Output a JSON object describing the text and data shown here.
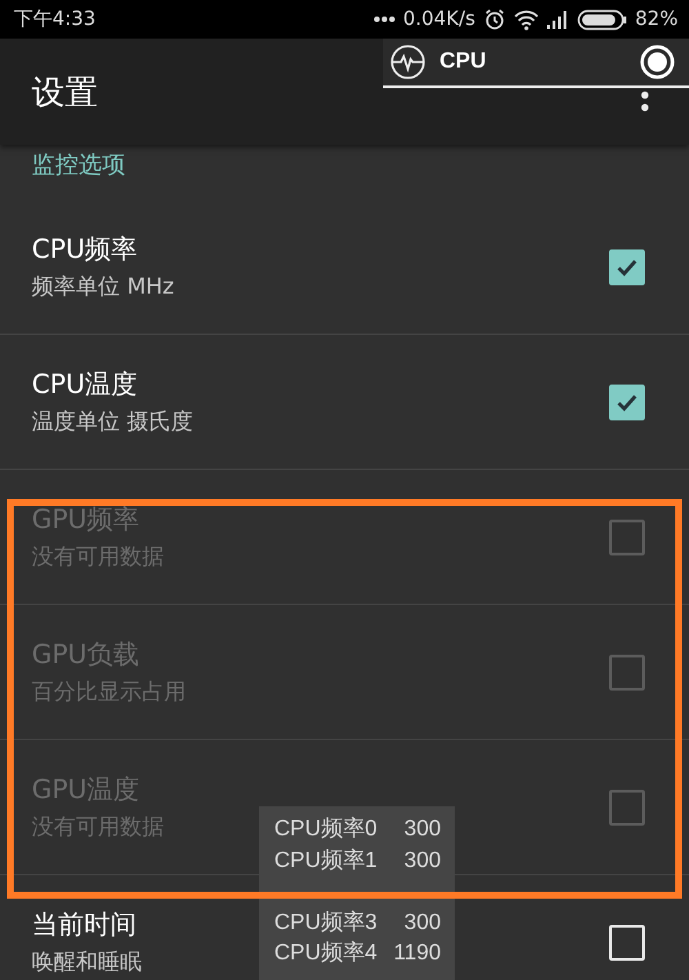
{
  "status_bar": {
    "time": "下午4:33",
    "net_speed": "0.04K/s",
    "battery": "82%"
  },
  "toolbar": {
    "title": "设置"
  },
  "widget": {
    "title": "CPU"
  },
  "section": "监控选项",
  "settings": [
    {
      "title": "CPU频率",
      "summary": "频率单位 MHz",
      "checked": true,
      "disabled": false
    },
    {
      "title": "CPU温度",
      "summary": "温度单位 摄氏度",
      "checked": true,
      "disabled": false
    },
    {
      "title": "GPU频率",
      "summary": "没有可用数据",
      "checked": false,
      "disabled": true
    },
    {
      "title": "GPU负载",
      "summary": "百分比显示占用",
      "checked": false,
      "disabled": true
    },
    {
      "title": "GPU温度",
      "summary": "没有可用数据",
      "checked": false,
      "disabled": true
    },
    {
      "title": "当前时间",
      "summary": "唤醒和睡眠",
      "checked": false,
      "disabled": false
    }
  ],
  "freq_popup": [
    {
      "label": "CPU频率0",
      "value": "300"
    },
    {
      "label": "CPU频率1",
      "value": "300"
    },
    {
      "label": "CPU频率3",
      "value": "300"
    },
    {
      "label": "CPU频率4",
      "value": "1190"
    }
  ]
}
